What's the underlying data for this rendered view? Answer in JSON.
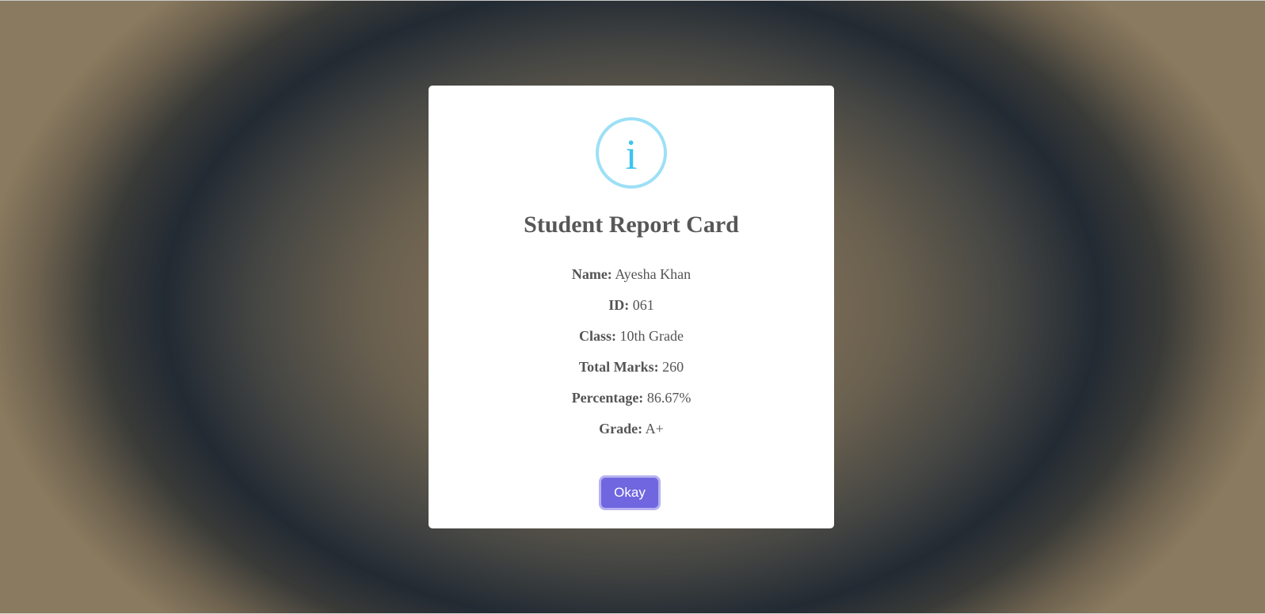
{
  "dialog": {
    "icon": "info-icon",
    "icon_glyph": "i",
    "title": "Student Report Card",
    "fields": [
      {
        "label": "Name:",
        "value": "Ayesha Khan"
      },
      {
        "label": "ID:",
        "value": "061"
      },
      {
        "label": "Class:",
        "value": "10th Grade"
      },
      {
        "label": "Total Marks:",
        "value": "260"
      },
      {
        "label": "Percentage:",
        "value": "86.67%"
      },
      {
        "label": "Grade:",
        "value": "A+"
      }
    ],
    "confirm_label": "Okay"
  },
  "colors": {
    "accent": "#7066e0",
    "info_icon": "#3fc3ee",
    "info_ring": "#9de0f6",
    "text": "#545454"
  }
}
